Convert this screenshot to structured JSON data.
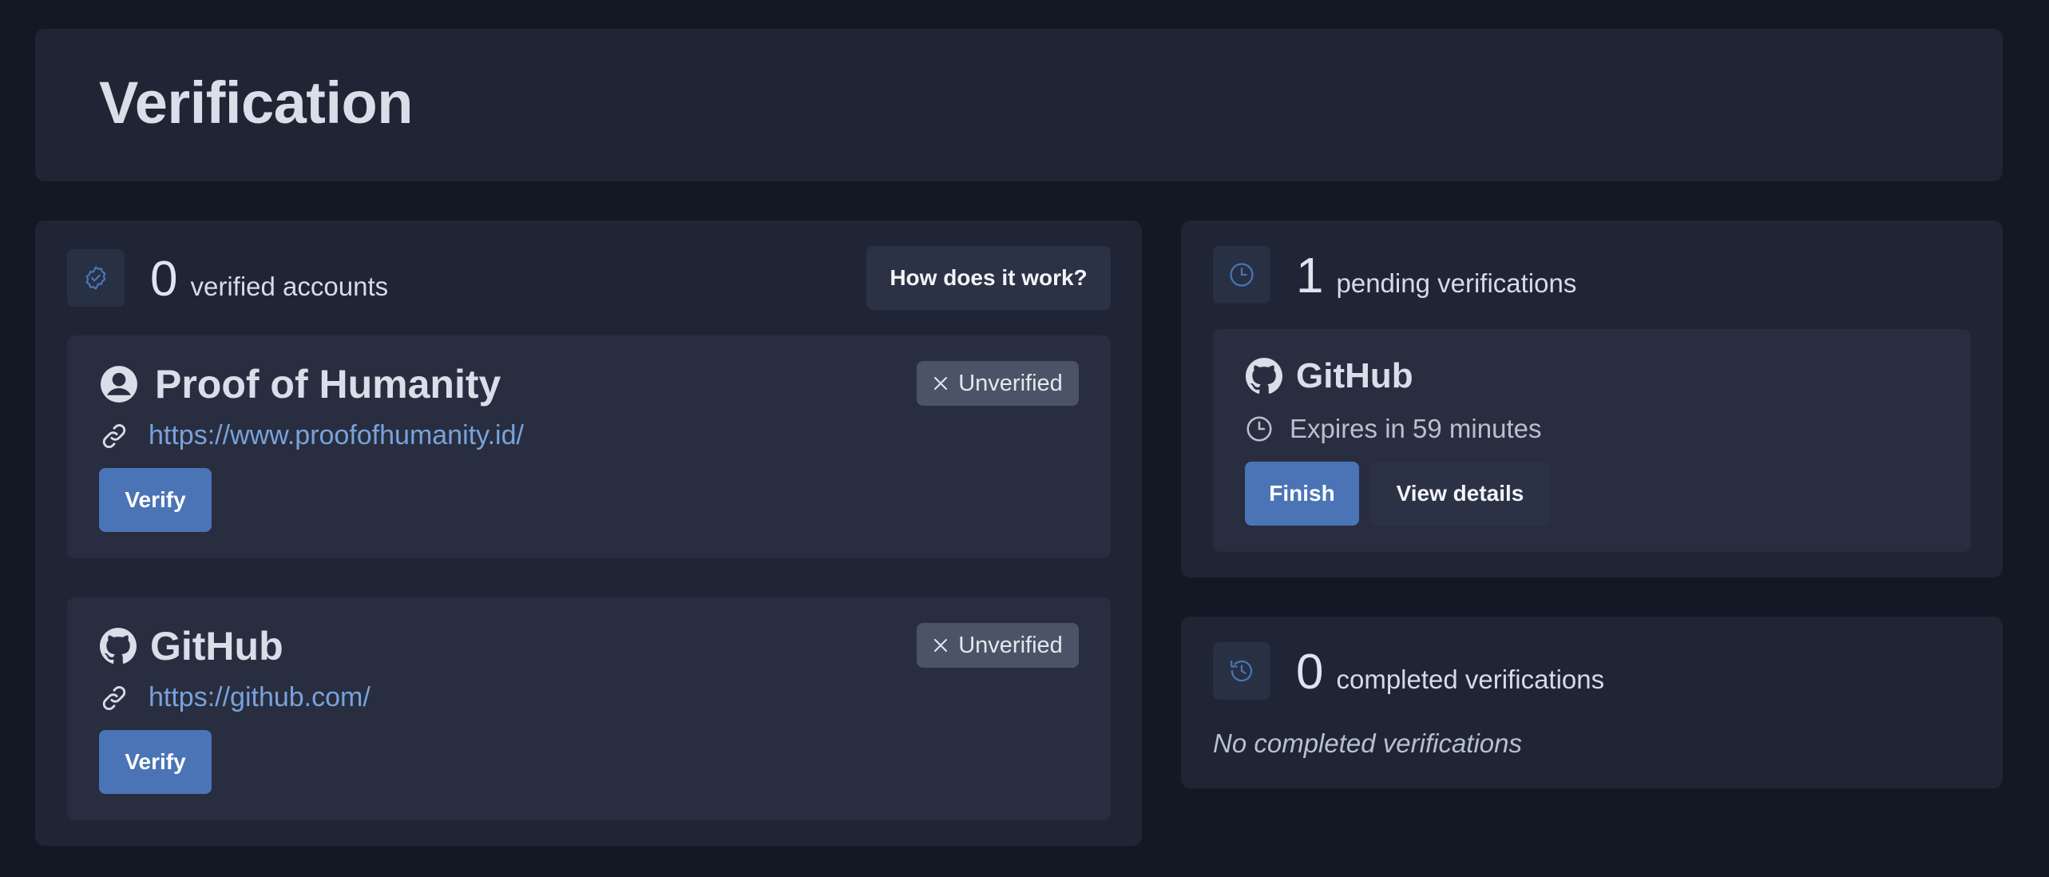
{
  "page": {
    "title": "Verification"
  },
  "verified": {
    "count": "0",
    "label": "verified accounts",
    "how_button": "How does it work?"
  },
  "providers": [
    {
      "name": "Proof of Humanity",
      "url": "https://www.proofofhumanity.id/",
      "status": "Unverified",
      "verify_label": "Verify",
      "icon": "user-circle-icon"
    },
    {
      "name": "GitHub",
      "url": "https://github.com/",
      "status": "Unverified",
      "verify_label": "Verify",
      "icon": "github-icon"
    }
  ],
  "pending": {
    "count": "1",
    "label": "pending verifications",
    "item": {
      "name": "GitHub",
      "expires": "Expires in 59 minutes",
      "finish_label": "Finish",
      "details_label": "View details"
    }
  },
  "completed": {
    "count": "0",
    "label": "completed verifications",
    "empty_text": "No completed verifications"
  },
  "colors": {
    "background": "#141824",
    "panel": "#1f2535",
    "card": "#282e3f",
    "accent": "#4a74b6",
    "link": "#79a2db",
    "badge": "#4b5466"
  }
}
